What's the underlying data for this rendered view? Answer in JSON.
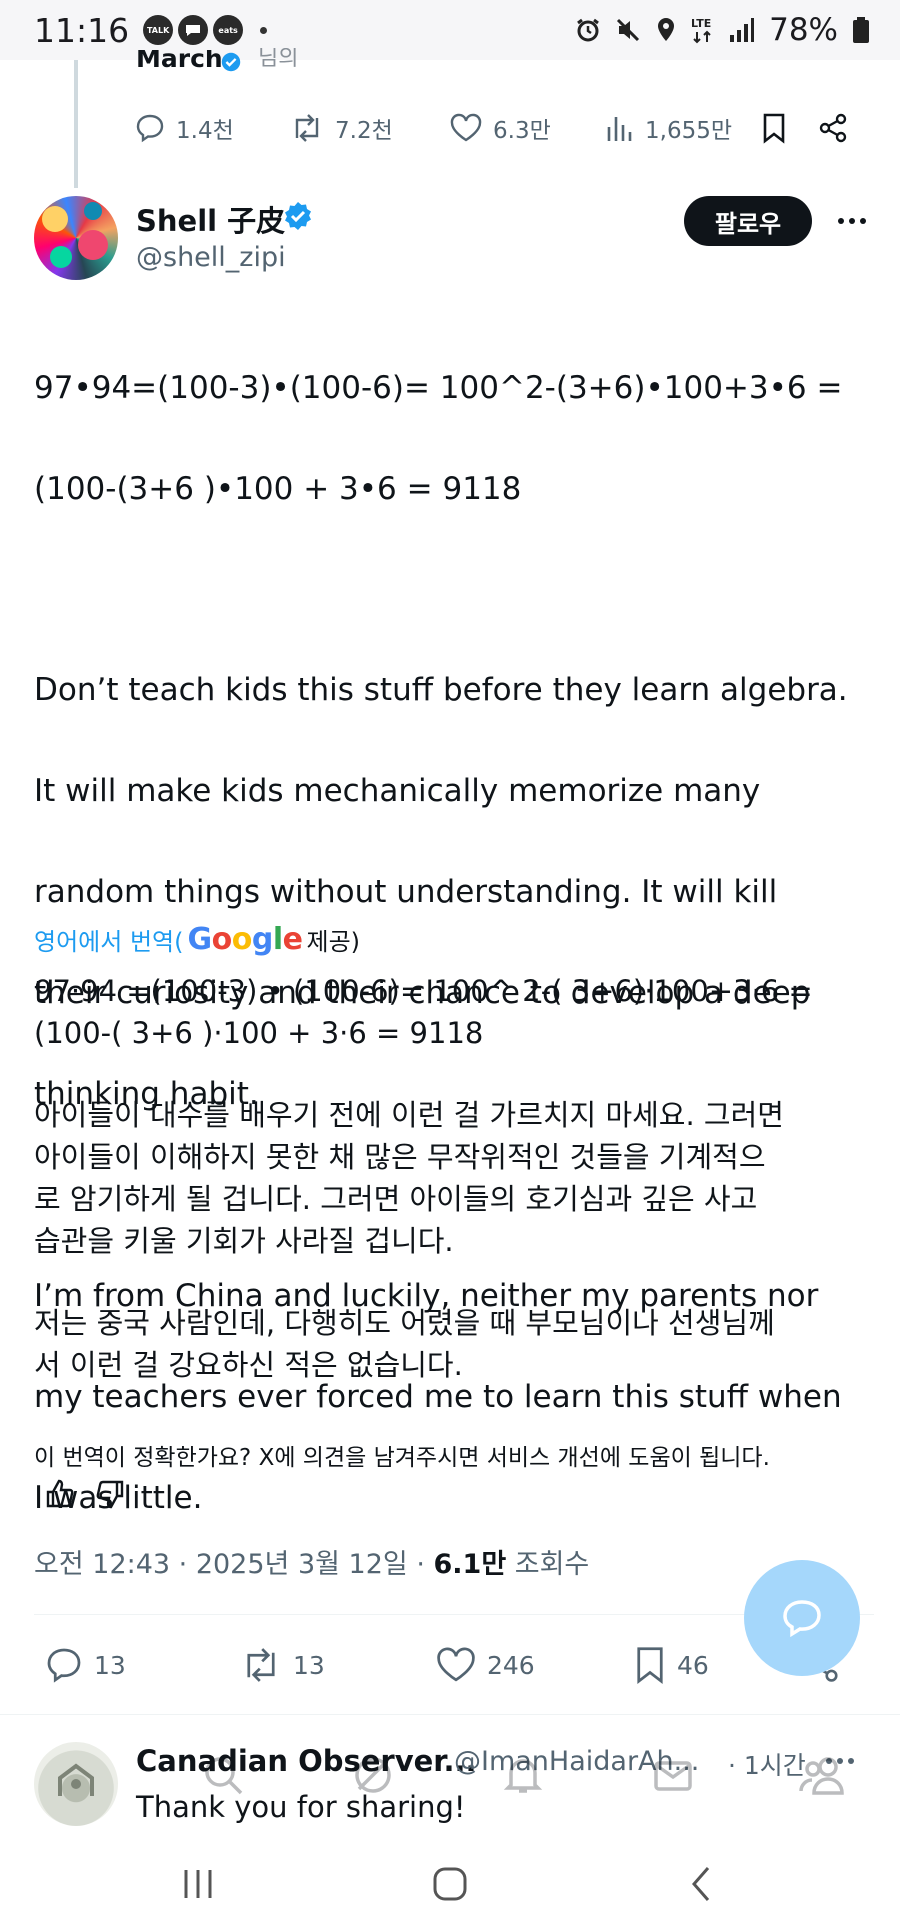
{
  "status_bar": {
    "time": "11:16",
    "app_badges": [
      "TALK",
      "",
      "eats"
    ],
    "battery": "78%",
    "network": "LTE"
  },
  "previous_tweet": {
    "name": "March",
    "sub": "님의",
    "replies": "1.4천",
    "reposts": "7.2천",
    "likes": "6.3만",
    "views": "1,655만"
  },
  "tweet": {
    "author_name": "Shell 子皮",
    "author_handle": "@shell_zipi",
    "follow_label": "팔로우",
    "text_lines": [
      "97•94=(100-3)•(100-6)= 100^2-(3+6)•100+3•6  =",
      "(100-(3+6 )•100 + 3•6 = 9118",
      "",
      "Don’t teach kids this stuff before they learn algebra.",
      "It will make kids mechanically memorize many",
      "random things without understanding. It will kill",
      "their curiosity and their chance to develop a deep",
      "thinking habit.",
      "",
      "I’m from China and luckily, neither my parents nor",
      "my teachers ever forced me to learn this stuff when",
      "I was little."
    ],
    "translate_prefix": "영어에서 번역(",
    "translate_provider": "Google",
    "translate_suffix": " 제공)",
    "translated_lines": [
      "97·94 =(100-3) • (100-6)= 100^ 2-( 3+6)·100+3·6 =",
      "(100-( 3+6 )·100 + 3·6 = 9118",
      "",
      "아이들이 대수를 배우기 전에 이런 걸 가르치지 마세요. 그러면",
      "아이들이 이해하지 못한 채 많은 무작위적인 것들을 기계적으",
      "로 암기하게 될 겁니다. 그러면 아이들의 호기심과 깊은 사고",
      "습관을 키울 기회가 사라질 겁니다.",
      "",
      "저는 중국 사람인데, 다행히도 어렸을 때 부모님이나 선생님께",
      "서 이런 걸 강요하신 적은 없습니다."
    ],
    "feedback_question": "이 번역이 정확한가요? X에 의견을 남겨주시면 서비스 개선에 도움이 됩니다.",
    "timestamp": "오전 12:43 · 2025년 3월 12일 · ",
    "views_count": "6.1만",
    "views_label": " 조회수",
    "replies": "13",
    "reposts": "13",
    "likes": "246",
    "bookmarks": "46"
  },
  "reply": {
    "name": "Canadian Observer...",
    "handle": "@ImanHaidarAh...",
    "time": "· 1시간",
    "text": "Thank you for sharing!"
  },
  "colors": {
    "accent": "#1d9bf0",
    "fab": "#a5d7fb",
    "text": "#0f1419",
    "muted": "#536471"
  }
}
